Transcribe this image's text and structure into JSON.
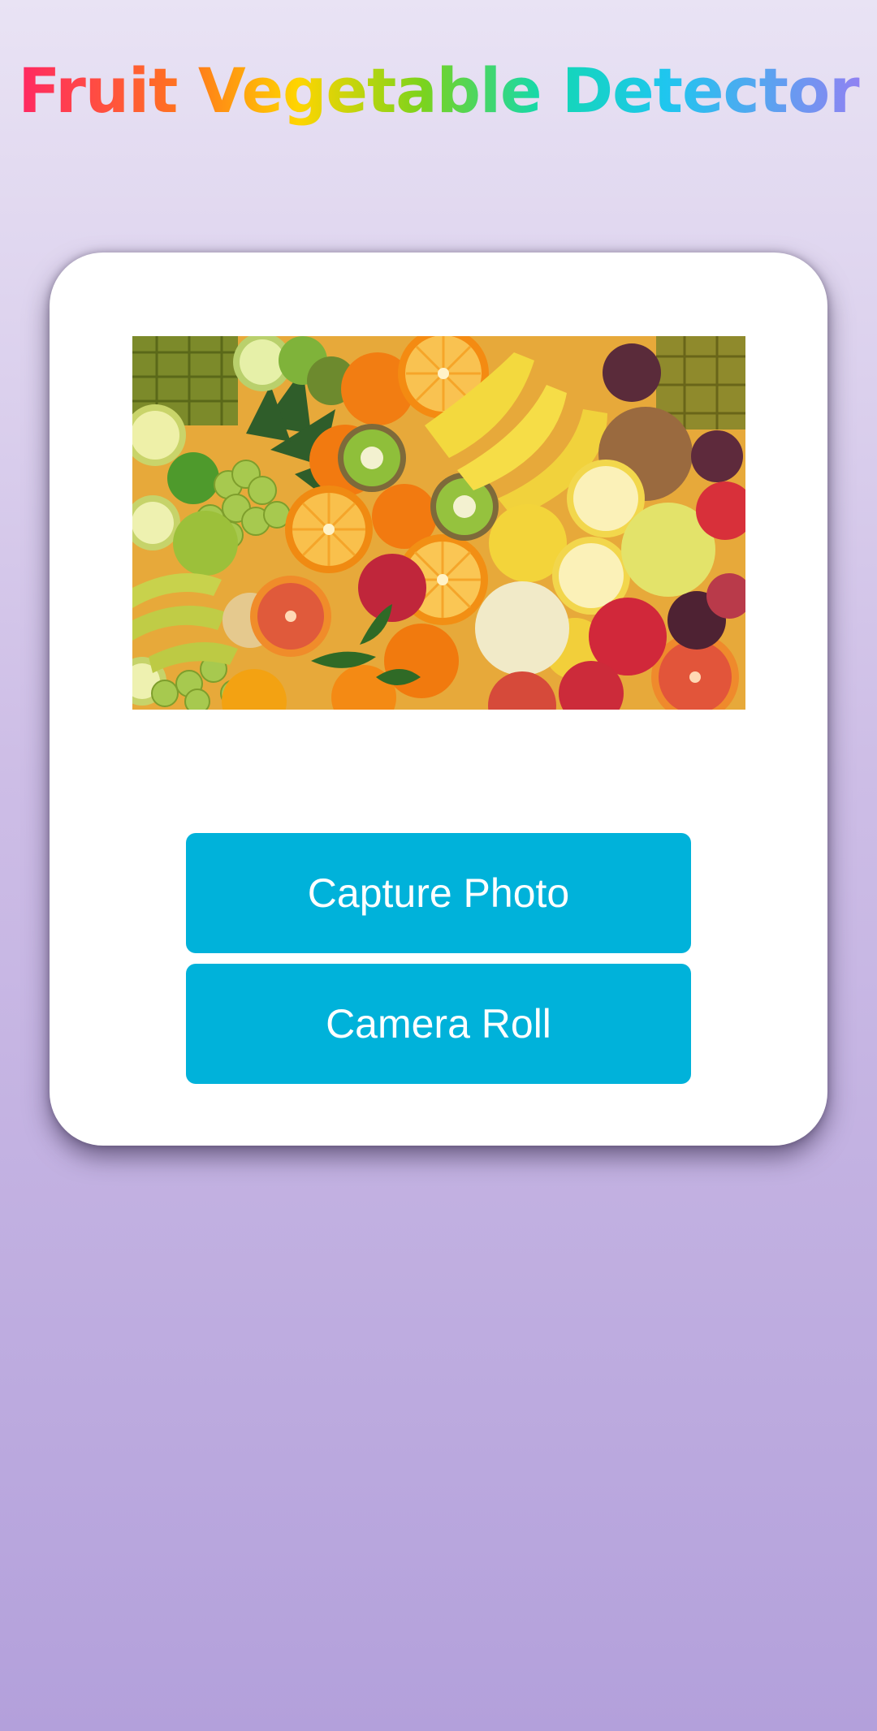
{
  "app": {
    "title": "Fruit Vegetable Detector"
  },
  "preview": {
    "icon": "fruit-photo",
    "alt": "Assorted fruits"
  },
  "actions": {
    "capture_label": "Capture Photo",
    "roll_label": "Camera Roll"
  },
  "colors": {
    "button": "#00b2da",
    "card": "#ffffff",
    "background_top": "#e9e3f4",
    "background_bottom": "#b3a0db"
  }
}
